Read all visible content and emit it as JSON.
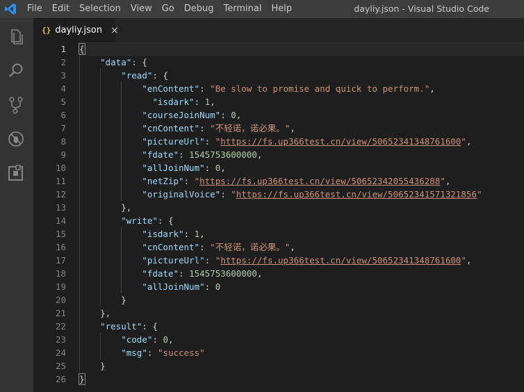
{
  "window": {
    "title": "dayliy.json - Visual Studio Code"
  },
  "menu": [
    "File",
    "Edit",
    "Selection",
    "View",
    "Go",
    "Debug",
    "Terminal",
    "Help"
  ],
  "activity": [
    "files-icon",
    "search-icon",
    "source-control-icon",
    "debug-icon",
    "extensions-icon"
  ],
  "tab": {
    "icon": "{}",
    "label": "dayliy.json",
    "close": "×"
  },
  "colors": {
    "key": "#9cdcfe",
    "string": "#ce9178",
    "number": "#b5cea8",
    "accent": "#007acc"
  },
  "editor": {
    "line_numbers": [
      "1",
      "2",
      "3",
      "4",
      "5",
      "6",
      "7",
      "8",
      "9",
      "10",
      "11",
      "12",
      "13",
      "14",
      "15",
      "16",
      "17",
      "18",
      "19",
      "20",
      "21",
      "22",
      "23",
      "24",
      "25",
      "26"
    ],
    "lines": [
      {
        "indent": 0,
        "tokens": [
          [
            "p",
            "{"
          ]
        ]
      },
      {
        "indent": 1,
        "tokens": [
          [
            "k",
            "\"data\""
          ],
          [
            "p",
            ": {"
          ]
        ]
      },
      {
        "indent": 2,
        "tokens": [
          [
            "k",
            "\"read\""
          ],
          [
            "p",
            ": {"
          ]
        ]
      },
      {
        "indent": 3,
        "tokens": [
          [
            "k",
            "\"enContent\""
          ],
          [
            "p",
            ": "
          ],
          [
            "s",
            "\"Be slow to promise and quick to perform.\""
          ],
          [
            "p",
            ","
          ]
        ]
      },
      {
        "indent": 3,
        "tokens": [
          [
            "p",
            "  "
          ],
          [
            "k",
            "\"isdark\""
          ],
          [
            "p",
            ": "
          ],
          [
            "n",
            "1"
          ],
          [
            "p",
            ","
          ]
        ]
      },
      {
        "indent": 3,
        "tokens": [
          [
            "k",
            "\"courseJoinNum\""
          ],
          [
            "p",
            ": "
          ],
          [
            "n",
            "0"
          ],
          [
            "p",
            ","
          ]
        ]
      },
      {
        "indent": 3,
        "tokens": [
          [
            "k",
            "\"cnContent\""
          ],
          [
            "p",
            ": "
          ],
          [
            "s",
            "\"不轻诺，诺必果。\""
          ],
          [
            "p",
            ","
          ]
        ]
      },
      {
        "indent": 3,
        "tokens": [
          [
            "k",
            "\"pictureUrl\""
          ],
          [
            "p",
            ": "
          ],
          [
            "s",
            "\""
          ],
          [
            "u",
            "https://fs.up366test.cn/view/50652341348761600"
          ],
          [
            "s",
            "\""
          ],
          [
            "p",
            ","
          ]
        ]
      },
      {
        "indent": 3,
        "tokens": [
          [
            "k",
            "\"fdate\""
          ],
          [
            "p",
            ": "
          ],
          [
            "n",
            "1545753600000"
          ],
          [
            "p",
            ","
          ]
        ]
      },
      {
        "indent": 3,
        "tokens": [
          [
            "k",
            "\"allJoinNum\""
          ],
          [
            "p",
            ": "
          ],
          [
            "n",
            "0"
          ],
          [
            "p",
            ","
          ]
        ]
      },
      {
        "indent": 3,
        "tokens": [
          [
            "k",
            "\"netZip\""
          ],
          [
            "p",
            ": "
          ],
          [
            "s",
            "\""
          ],
          [
            "u",
            "https://fs.up366test.cn/view/50652342055436288"
          ],
          [
            "s",
            "\""
          ],
          [
            "p",
            ","
          ]
        ]
      },
      {
        "indent": 3,
        "tokens": [
          [
            "k",
            "\"originalVoice\""
          ],
          [
            "p",
            ": "
          ],
          [
            "s",
            "\""
          ],
          [
            "u",
            "https://fs.up366test.cn/view/50652341571321856"
          ],
          [
            "s",
            "\""
          ]
        ]
      },
      {
        "indent": 2,
        "tokens": [
          [
            "p",
            "},"
          ]
        ]
      },
      {
        "indent": 2,
        "tokens": [
          [
            "k",
            "\"write\""
          ],
          [
            "p",
            ": {"
          ]
        ]
      },
      {
        "indent": 3,
        "tokens": [
          [
            "k",
            "\"isdark\""
          ],
          [
            "p",
            ": "
          ],
          [
            "n",
            "1"
          ],
          [
            "p",
            ","
          ]
        ]
      },
      {
        "indent": 3,
        "tokens": [
          [
            "k",
            "\"cnContent\""
          ],
          [
            "p",
            ": "
          ],
          [
            "s",
            "\"不轻诺，诺必果。\""
          ],
          [
            "p",
            ","
          ]
        ]
      },
      {
        "indent": 3,
        "tokens": [
          [
            "k",
            "\"pictureUrl\""
          ],
          [
            "p",
            ": "
          ],
          [
            "s",
            "\""
          ],
          [
            "u",
            "https://fs.up366test.cn/view/50652341348761600"
          ],
          [
            "s",
            "\""
          ],
          [
            "p",
            ","
          ]
        ]
      },
      {
        "indent": 3,
        "tokens": [
          [
            "k",
            "\"fdate\""
          ],
          [
            "p",
            ": "
          ],
          [
            "n",
            "1545753600000"
          ],
          [
            "p",
            ","
          ]
        ]
      },
      {
        "indent": 3,
        "tokens": [
          [
            "k",
            "\"allJoinNum\""
          ],
          [
            "p",
            ": "
          ],
          [
            "n",
            "0"
          ]
        ]
      },
      {
        "indent": 2,
        "tokens": [
          [
            "p",
            "}"
          ]
        ]
      },
      {
        "indent": 1,
        "tokens": [
          [
            "p",
            "},"
          ]
        ]
      },
      {
        "indent": 1,
        "tokens": [
          [
            "k",
            "\"result\""
          ],
          [
            "p",
            ": {"
          ]
        ]
      },
      {
        "indent": 2,
        "tokens": [
          [
            "k",
            "\"code\""
          ],
          [
            "p",
            ": "
          ],
          [
            "n",
            "0"
          ],
          [
            "p",
            ","
          ]
        ]
      },
      {
        "indent": 2,
        "tokens": [
          [
            "k",
            "\"msg\""
          ],
          [
            "p",
            ": "
          ],
          [
            "s",
            "\"success\""
          ]
        ]
      },
      {
        "indent": 1,
        "tokens": [
          [
            "p",
            "}"
          ]
        ]
      },
      {
        "indent": 0,
        "tokens": [
          [
            "p",
            "}"
          ]
        ]
      }
    ]
  }
}
